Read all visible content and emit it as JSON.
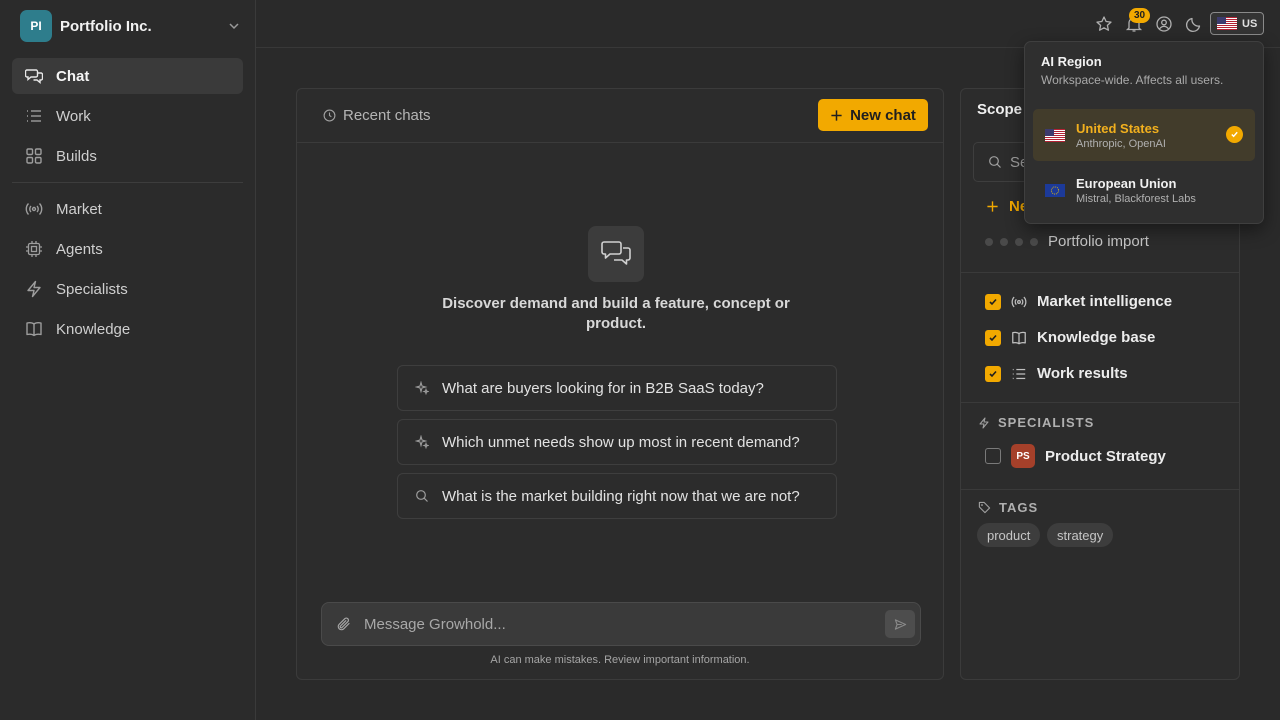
{
  "workspace": {
    "initials": "PI",
    "name": "Portfolio Inc."
  },
  "nav": {
    "primary": [
      {
        "label": "Chat",
        "icon": "chat-bubbles-icon",
        "active": true
      },
      {
        "label": "Work",
        "icon": "list-icon"
      },
      {
        "label": "Builds",
        "icon": "grid-icon"
      }
    ],
    "secondary": [
      {
        "label": "Market",
        "icon": "broadcast-icon"
      },
      {
        "label": "Agents",
        "icon": "chip-icon"
      },
      {
        "label": "Specialists",
        "icon": "lightning-icon"
      },
      {
        "label": "Knowledge",
        "icon": "book-icon"
      }
    ]
  },
  "topbar": {
    "notification_count": "30",
    "region_code": "US"
  },
  "chat": {
    "recent_label": "Recent chats",
    "new_chat_label": "New chat",
    "empty_text": "Discover demand and build a feature, concept or product.",
    "suggestions": [
      {
        "text": "What are buyers looking for in B2B SaaS today?",
        "icon": "sparkle-icon"
      },
      {
        "text": "Which unmet needs show up most in recent demand?",
        "icon": "sparkle-icon"
      },
      {
        "text": "What is the market building right now that we are not?",
        "icon": "search-icon"
      }
    ],
    "composer_placeholder": "Message Growhold...",
    "disclaimer": "AI can make mistakes. Review important information."
  },
  "scope": {
    "title": "Scope",
    "search_placeholder": "Se",
    "new_label": "Ne",
    "import_label": "Portfolio import",
    "sources": [
      {
        "label": "Market intelligence",
        "checked": true,
        "icon": "broadcast-icon"
      },
      {
        "label": "Knowledge base",
        "checked": true,
        "icon": "book-icon"
      },
      {
        "label": "Work results",
        "checked": true,
        "icon": "list-icon"
      }
    ],
    "specialists_heading": "SPECIALISTS",
    "specialists": [
      {
        "initials": "PS",
        "label": "Product Strategy",
        "checked": false
      }
    ],
    "tags_heading": "TAGS",
    "tags": [
      "product",
      "strategy"
    ]
  },
  "region_menu": {
    "title": "AI Region",
    "subtitle": "Workspace-wide. Affects all users.",
    "options": [
      {
        "name": "United States",
        "providers": "Anthropic, OpenAI",
        "selected": true,
        "flag": "us-flag-icon"
      },
      {
        "name": "European Union",
        "providers": "Mistral, Blackforest Labs",
        "selected": false,
        "flag": "eu-flag-icon"
      }
    ]
  },
  "colors": {
    "accent": "#f2a900",
    "background": "#2a2a2a",
    "workspace_avatar": "#2e7d8c",
    "specialist_avatar": "#a5402a"
  }
}
